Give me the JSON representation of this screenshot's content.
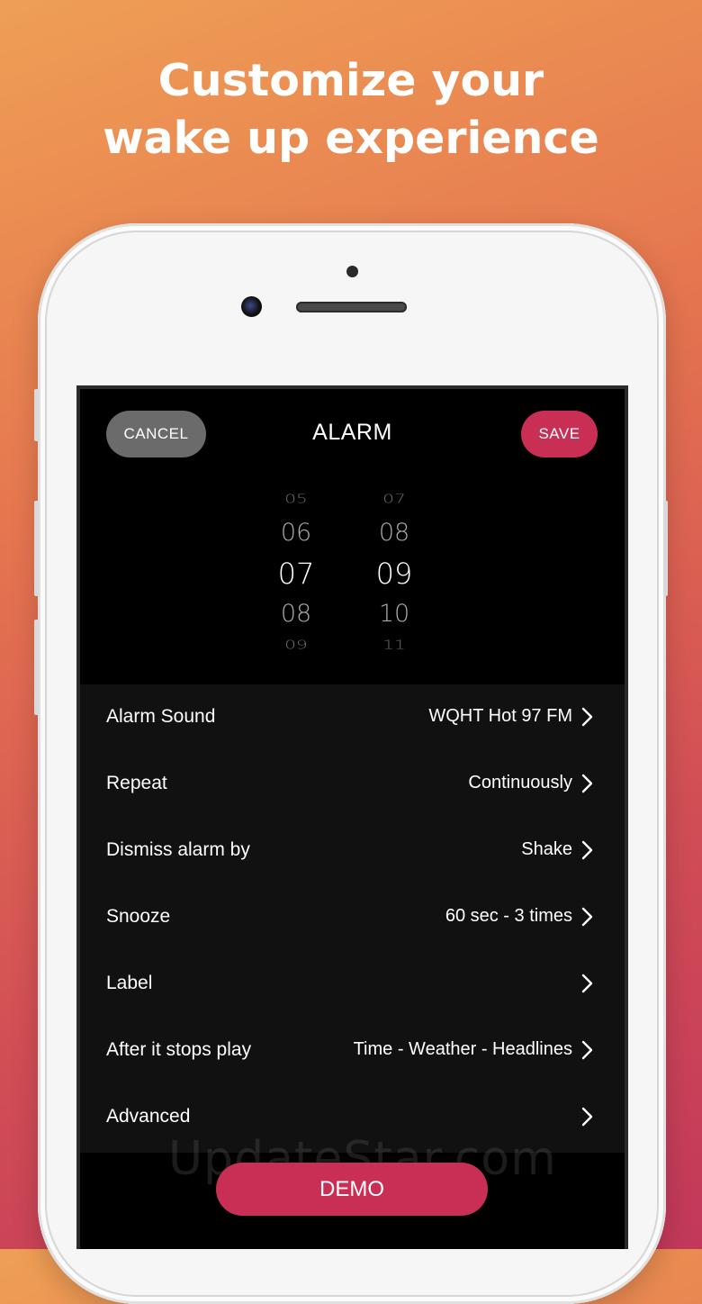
{
  "headline": {
    "line1": "Customize your",
    "line2": "wake up experience"
  },
  "header": {
    "cancel_label": "CANCEL",
    "title": "ALARM",
    "save_label": "SAVE"
  },
  "picker": {
    "hours": [
      "05",
      "06",
      "07",
      "08",
      "09"
    ],
    "minutes": [
      "07",
      "08",
      "09",
      "10",
      "11"
    ],
    "selected_hour": "07",
    "selected_minute": "09"
  },
  "settings": [
    {
      "label": "Alarm Sound",
      "value": "WQHT Hot 97 FM"
    },
    {
      "label": "Repeat",
      "value": "Continuously"
    },
    {
      "label": "Dismiss alarm by",
      "value": "Shake"
    },
    {
      "label": "Snooze",
      "value": "60 sec - 3 times"
    },
    {
      "label": "Label",
      "value": ""
    },
    {
      "label": "After it stops play",
      "value": "Time - Weather - Headlines"
    },
    {
      "label": "Advanced",
      "value": ""
    }
  ],
  "demo_label": "DEMO",
  "watermark": "UpdateStar.com",
  "colors": {
    "accent": "#c92f55",
    "cancel_bg": "#6b6b6b",
    "settings_bg": "#111112"
  }
}
